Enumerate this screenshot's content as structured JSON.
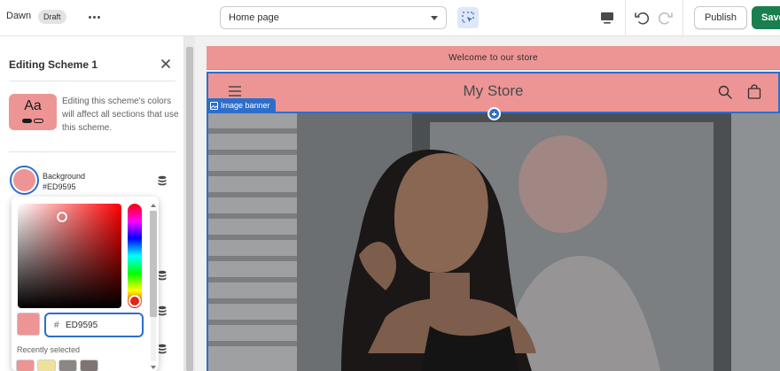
{
  "topbar": {
    "theme_name": "Dawn",
    "status_badge": "Draft",
    "page_select_value": "Home page",
    "publish_label": "Publish",
    "save_label": "Save"
  },
  "panel": {
    "title": "Editing Scheme 1",
    "swatch_preview_text": "Aa",
    "info_text": "Editing this scheme's colors will affect all sections that use this scheme.",
    "background": {
      "label": "Background",
      "value": "#ED9595"
    }
  },
  "picker": {
    "hex_prefix": "#",
    "hex_value": "ED9595",
    "recent_label": "Recently selected",
    "recent_colors": [
      "#ED9595",
      "#f0e19a",
      "#8a8784",
      "#7e7573"
    ]
  },
  "preview": {
    "announcement": "Welcome to our store",
    "store_title": "My Store",
    "section_tag": "Image banner"
  },
  "colors": {
    "scheme_background": "#ED9595",
    "accent": "#2c6ecb",
    "save_green": "#1a7f4e"
  }
}
